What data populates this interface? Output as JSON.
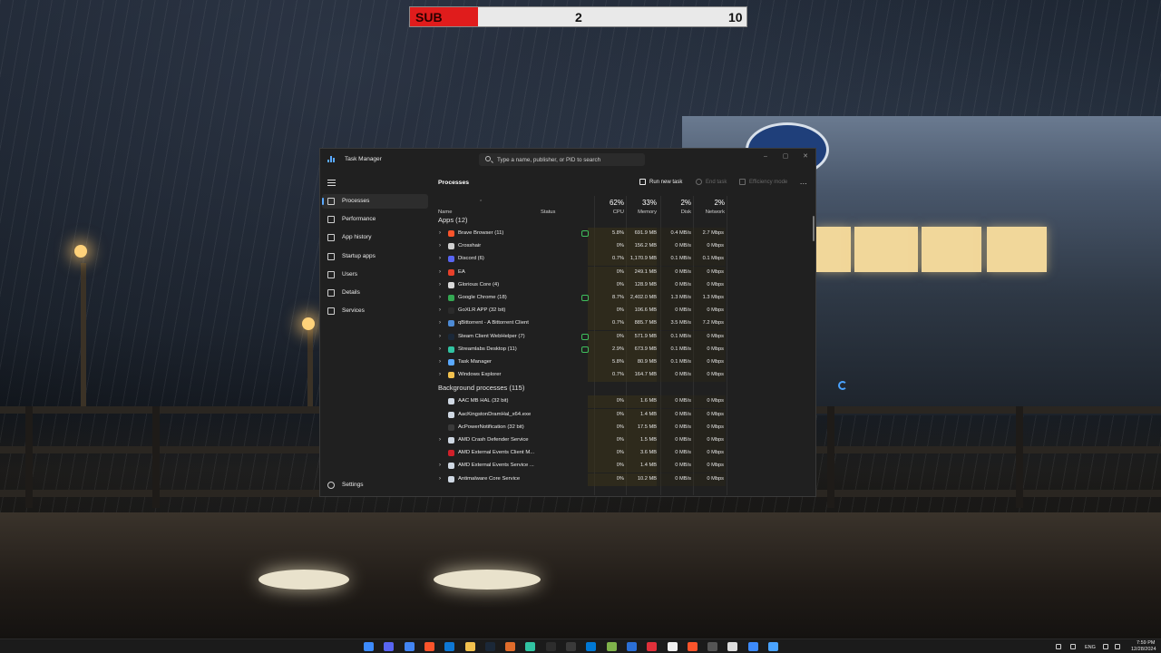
{
  "scoreboard": {
    "label": "SUB",
    "current": "2",
    "goal": "10"
  },
  "window": {
    "title": "Task Manager",
    "search_placeholder": "Type a name, publisher, or PID to search",
    "controls": [
      "–",
      "▢",
      "✕"
    ]
  },
  "sidebar": {
    "items": [
      {
        "label": "Processes",
        "icon": "processes-icon",
        "active": true
      },
      {
        "label": "Performance",
        "icon": "performance-icon"
      },
      {
        "label": "App history",
        "icon": "app-history-icon"
      },
      {
        "label": "Startup apps",
        "icon": "startup-apps-icon"
      },
      {
        "label": "Users",
        "icon": "users-icon"
      },
      {
        "label": "Details",
        "icon": "details-icon"
      },
      {
        "label": "Services",
        "icon": "services-icon"
      }
    ],
    "settings_label": "Settings"
  },
  "toolbar": {
    "title": "Processes",
    "run_new_task": "Run new task",
    "end_task": "End task",
    "efficiency_mode": "Efficiency mode",
    "more": "..."
  },
  "columns": {
    "name": "Name",
    "status": "Status",
    "cpu": {
      "pct": "62%",
      "label": "CPU"
    },
    "memory": {
      "pct": "33%",
      "label": "Memory"
    },
    "disk": {
      "pct": "2%",
      "label": "Disk"
    },
    "network": {
      "pct": "2%",
      "label": "Network"
    }
  },
  "apps_header": "Apps (12)",
  "apps": [
    {
      "name": "Brave Browser (11)",
      "cpu": "5.8%",
      "mem": "691.9 MB",
      "disk": "0.4 MB/s",
      "net": "2.7 Mbps",
      "leaf": true,
      "color": "#fb542b",
      "chev": true
    },
    {
      "name": "Crosshair",
      "cpu": "0%",
      "mem": "156.2 MB",
      "disk": "0 MB/s",
      "net": "0 Mbps",
      "leaf": false,
      "color": "#cfcfcf",
      "chev": true
    },
    {
      "name": "Discord (6)",
      "cpu": "0.7%",
      "mem": "1,170.9 MB",
      "disk": "0.1 MB/s",
      "net": "0.1 Mbps",
      "leaf": false,
      "color": "#5865f2",
      "chev": true
    },
    {
      "name": "EA",
      "cpu": "0%",
      "mem": "249.1 MB",
      "disk": "0 MB/s",
      "net": "0 Mbps",
      "leaf": false,
      "color": "#e8402a",
      "chev": true
    },
    {
      "name": "Glorious Core (4)",
      "cpu": "0%",
      "mem": "128.9 MB",
      "disk": "0 MB/s",
      "net": "0 Mbps",
      "leaf": false,
      "color": "#d9d9d9",
      "chev": true
    },
    {
      "name": "Google Chrome (18)",
      "cpu": "8.7%",
      "mem": "2,402.0 MB",
      "disk": "1.3 MB/s",
      "net": "1.3 Mbps",
      "leaf": true,
      "color": "#34a853",
      "chev": true
    },
    {
      "name": "GoXLR APP (32 bit)",
      "cpu": "0%",
      "mem": "106.6 MB",
      "disk": "0 MB/s",
      "net": "0 Mbps",
      "leaf": false,
      "color": "#2b2b2b",
      "chev": true
    },
    {
      "name": "qBittorrent - A Bittorrent Client",
      "cpu": "0.7%",
      "mem": "885.7 MB",
      "disk": "3.5 MB/s",
      "net": "7.2 Mbps",
      "leaf": false,
      "color": "#4d8bd6",
      "chev": true
    },
    {
      "name": "Steam Client WebHelper (7)",
      "cpu": "0%",
      "mem": "571.9 MB",
      "disk": "0.1 MB/s",
      "net": "0 Mbps",
      "leaf": true,
      "color": "#1b2838",
      "chev": true
    },
    {
      "name": "Streamlabs Desktop (11)",
      "cpu": "2.9%",
      "mem": "673.9 MB",
      "disk": "0.1 MB/s",
      "net": "0 Mbps",
      "leaf": true,
      "color": "#31c3a2",
      "chev": true
    },
    {
      "name": "Task Manager",
      "cpu": "5.8%",
      "mem": "80.9 MB",
      "disk": "0.1 MB/s",
      "net": "0 Mbps",
      "leaf": false,
      "color": "#5aa9ff",
      "chev": true
    },
    {
      "name": "Windows Explorer",
      "cpu": "0.7%",
      "mem": "164.7 MB",
      "disk": "0 MB/s",
      "net": "0 Mbps",
      "leaf": false,
      "color": "#f2c14e",
      "chev": true
    }
  ],
  "bg_header": "Background processes (115)",
  "background": [
    {
      "name": "AAC MB HAL (32 bit)",
      "cpu": "0%",
      "mem": "1.6 MB",
      "disk": "0 MB/s",
      "net": "0 Mbps",
      "color": "#cfd8e3",
      "chev": false
    },
    {
      "name": "AacKingstonDramHal_x64.exe",
      "cpu": "0%",
      "mem": "1.4 MB",
      "disk": "0 MB/s",
      "net": "0 Mbps",
      "color": "#cfd8e3",
      "chev": false
    },
    {
      "name": "AcPowerNotification (32 bit)",
      "cpu": "0%",
      "mem": "17.5 MB",
      "disk": "0 MB/s",
      "net": "0 Mbps",
      "color": "#3a3a3a",
      "chev": false
    },
    {
      "name": "AMD Crash Defender Service",
      "cpu": "0%",
      "mem": "1.5 MB",
      "disk": "0 MB/s",
      "net": "0 Mbps",
      "color": "#cfd8e3",
      "chev": true
    },
    {
      "name": "AMD External Events Client M...",
      "cpu": "0%",
      "mem": "3.6 MB",
      "disk": "0 MB/s",
      "net": "0 Mbps",
      "color": "#d0202a",
      "chev": false
    },
    {
      "name": "AMD External Events Service ...",
      "cpu": "0%",
      "mem": "1.4 MB",
      "disk": "0 MB/s",
      "net": "0 Mbps",
      "color": "#cfd8e3",
      "chev": true
    },
    {
      "name": "Antimalware Core Service",
      "cpu": "0%",
      "mem": "10.2 MB",
      "disk": "0 MB/s",
      "net": "0 Mbps",
      "color": "#cfd8e3",
      "chev": true
    }
  ],
  "tray": {
    "lang": "ENG",
    "time": "7:59 PM",
    "date": "12/28/2024"
  }
}
